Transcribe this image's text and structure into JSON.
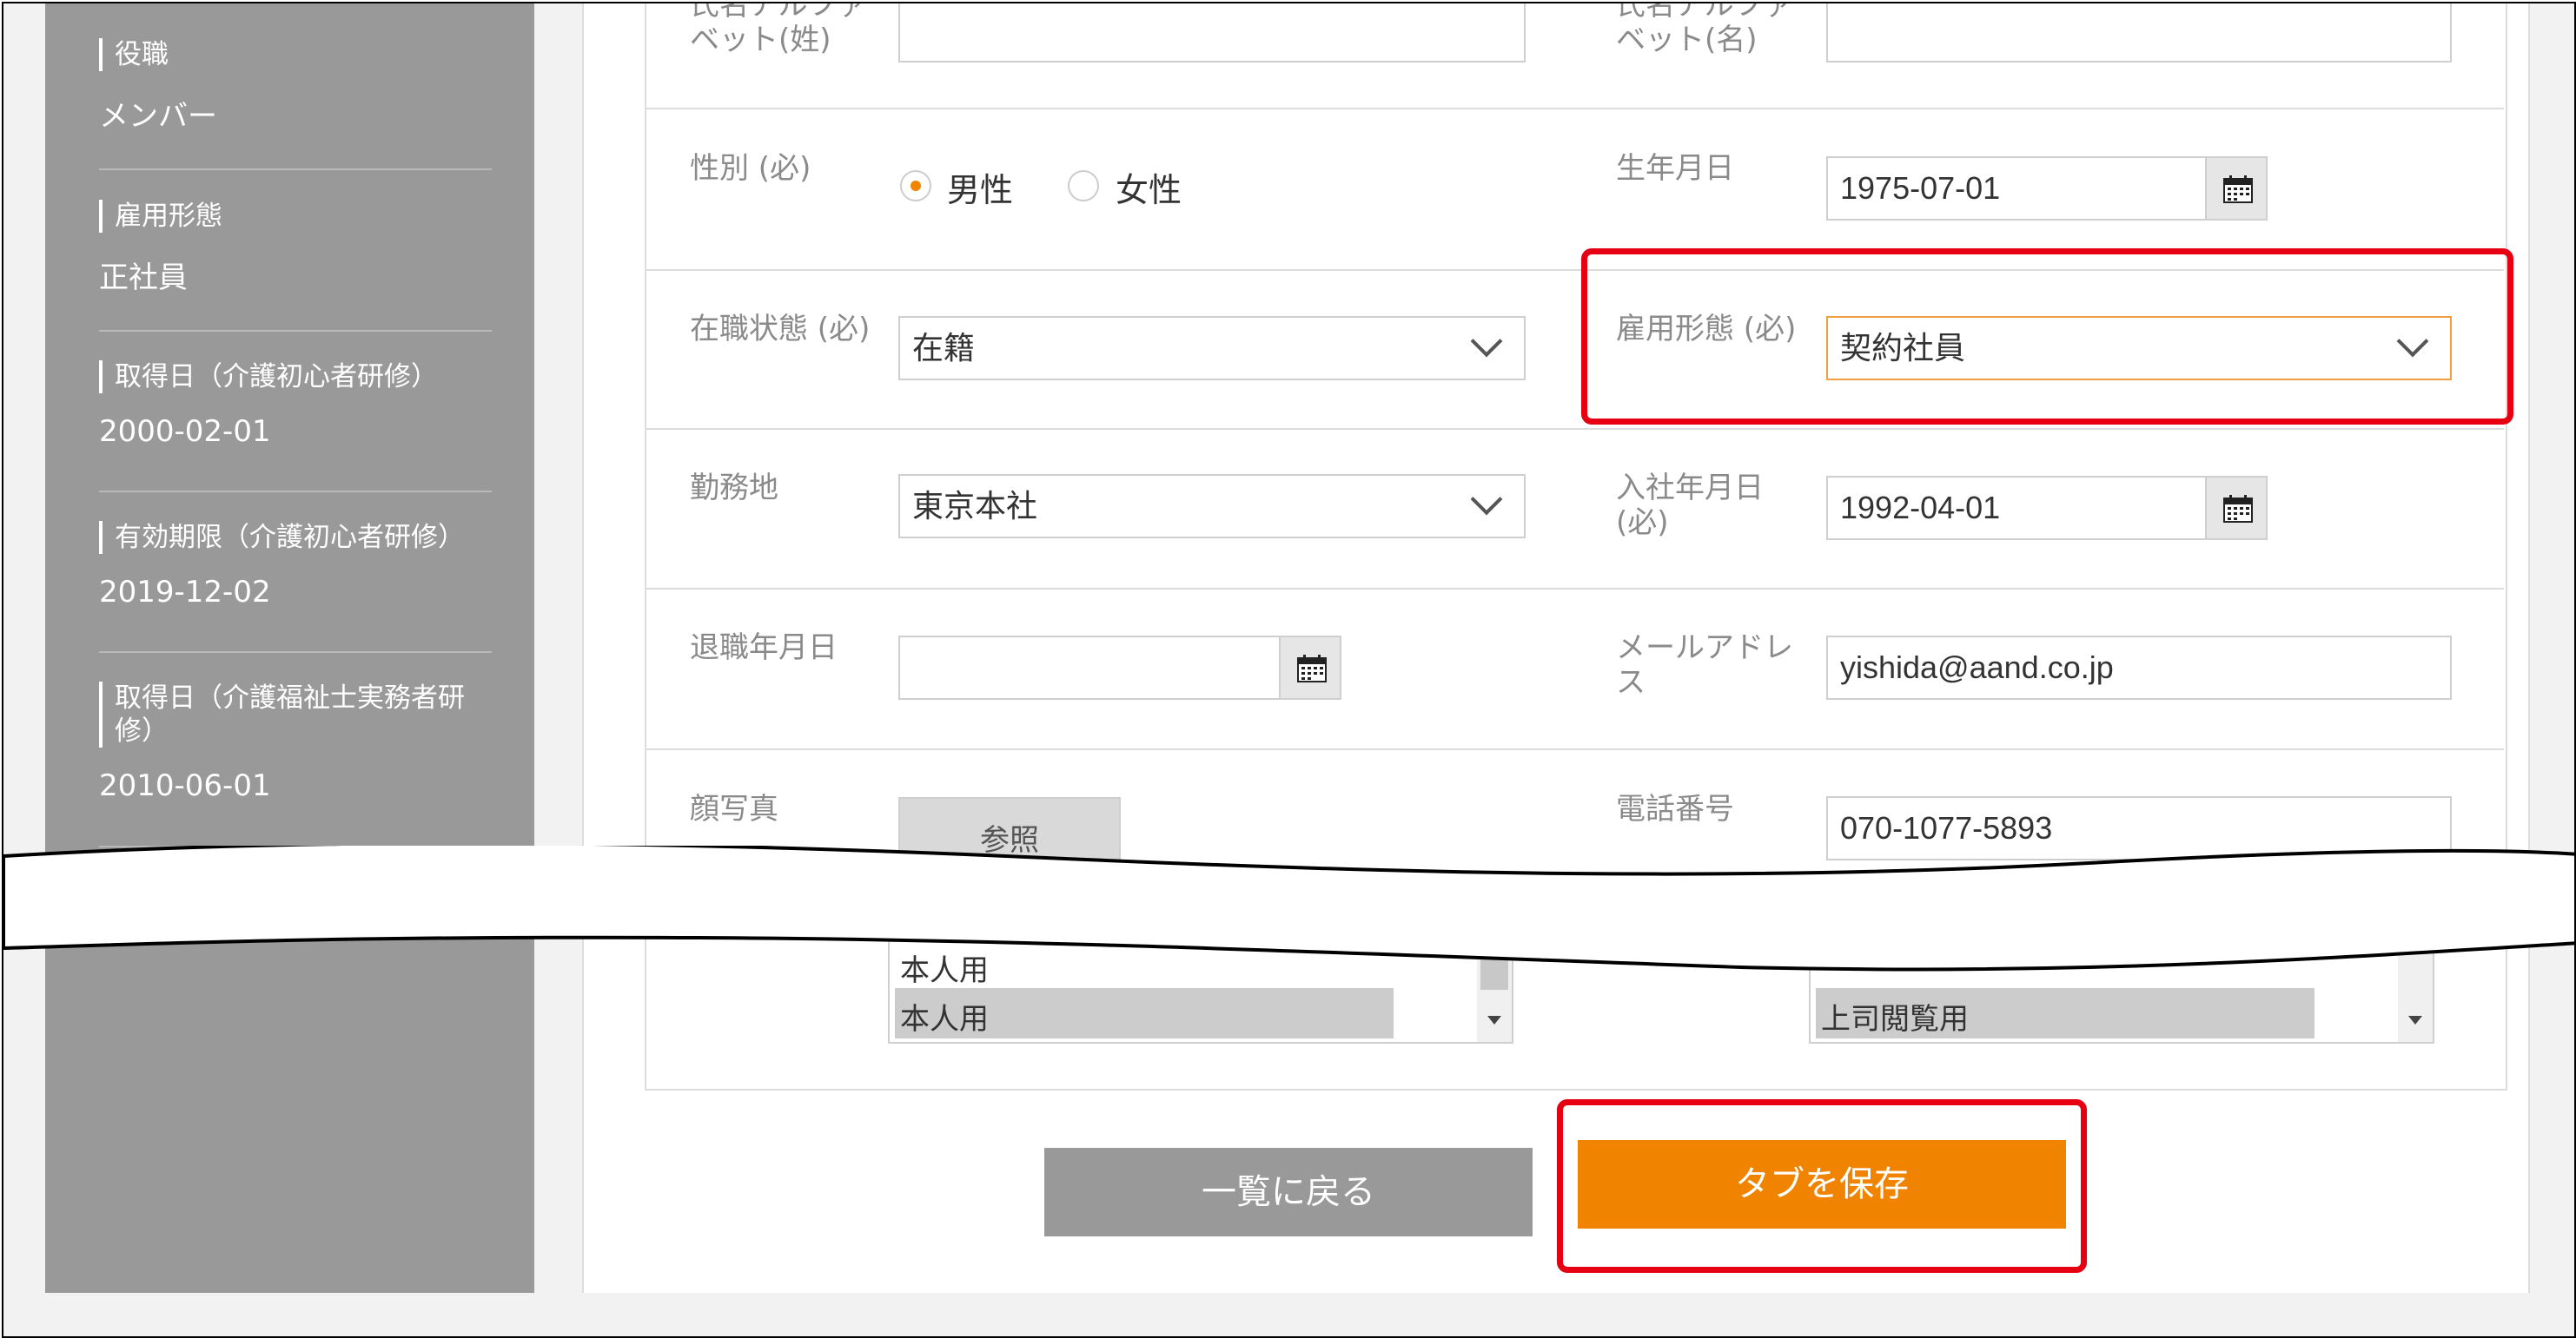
{
  "sidebar": {
    "items": [
      {
        "label": "役職",
        "value": "メンバー"
      },
      {
        "label": "雇用形態",
        "value": "正社員"
      },
      {
        "label": "取得日（介護初心者研修）",
        "value": "2000-02-01"
      },
      {
        "label": "有効期限（介護初心者研修）",
        "value": "2019-12-02"
      },
      {
        "label_line1": "取得日（介護福祉士実務者研",
        "label_line2": "修）",
        "value": "2010-06-01"
      }
    ]
  },
  "form": {
    "alpha_last": {
      "line1": "氏名アルファ",
      "line2": "ベット(姓)",
      "value": ""
    },
    "alpha_first": {
      "line1": "氏名アルファ",
      "line2": "ベット(名)",
      "value": ""
    },
    "gender": {
      "label": "性別 (必)",
      "options": [
        "男性",
        "女性"
      ],
      "selected": "男性"
    },
    "birthdate": {
      "label": "生年月日",
      "value": "1975-07-01"
    },
    "status": {
      "label": "在職状態 (必)",
      "value": "在籍"
    },
    "employment_type": {
      "label": "雇用形態 (必)",
      "value": "契約社員"
    },
    "workplace": {
      "label": "勤務地",
      "value": "東京本社"
    },
    "hire_date": {
      "line1": "入社年月日",
      "line2": "(必)",
      "value": "1992-04-01"
    },
    "leave_date": {
      "label": "退職年月日",
      "value": ""
    },
    "email": {
      "line1": "メールアドレ",
      "line2": "ス",
      "value": "yishida@aand.co.jp"
    },
    "photo": {
      "label": "顔写真",
      "browse_label": "参照"
    },
    "phone": {
      "label": "電話番号",
      "value": "070-1077-5893"
    },
    "list_left": {
      "options": [
        "本人用",
        "本人用"
      ]
    },
    "list_right": {
      "options": [
        "上司閲覧用"
      ]
    }
  },
  "buttons": {
    "back": "一覧に戻る",
    "save": "タブを保存"
  },
  "colors": {
    "accent": "#f08300",
    "highlight": "#e60012",
    "sidebar": "#999999"
  }
}
